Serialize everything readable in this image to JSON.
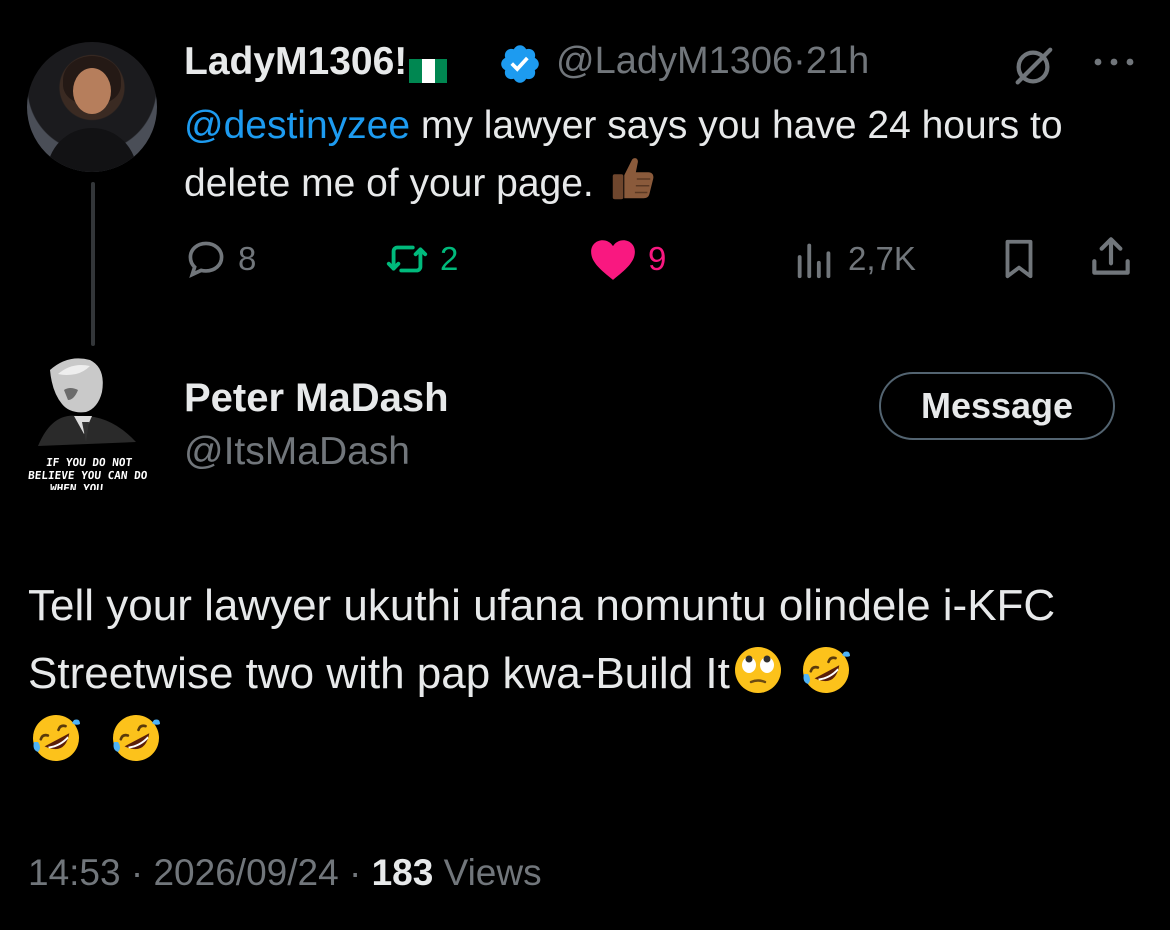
{
  "parent_tweet": {
    "display_name": "LadyM1306!",
    "flag": "Nigeria flag",
    "verified": true,
    "handle": "@LadyM1306",
    "separator": "·",
    "time_ago": "21h",
    "mention": "@destinyzee",
    "text": " my lawyer says you have 24 hours to delete me of your page. ",
    "emoji": "thumbs-up-medium-dark",
    "actions": {
      "replies": "8",
      "retweets": "2",
      "likes": "9",
      "views": "2,7K"
    }
  },
  "reply_tweet": {
    "display_name": "Peter MaDash",
    "handle": "@ItsMaDash",
    "avatar_caption_lines": [
      "IF YOU DO NOT",
      "BELIEVE YOU CAN DO",
      "WHEN YOU..."
    ],
    "message_button_label": "Message",
    "text": "Tell your lawyer ukuthi ufana nomuntu olindele i-KFC Streetwise two with pap kwa-Build It",
    "emojis": [
      "face-with-rolling-eyes",
      "rolling-on-the-floor-laughing",
      "rolling-on-the-floor-laughing",
      "rolling-on-the-floor-laughing"
    ],
    "time": "14:53",
    "date": "2026/09/24",
    "views_count": "183",
    "views_label": "Views"
  },
  "colors": {
    "background": "#000000",
    "primary_text": "#e7e9ea",
    "secondary_text": "#71767b",
    "link": "#1d9bf0",
    "retweet": "#00ba7c",
    "like": "#f91880"
  }
}
